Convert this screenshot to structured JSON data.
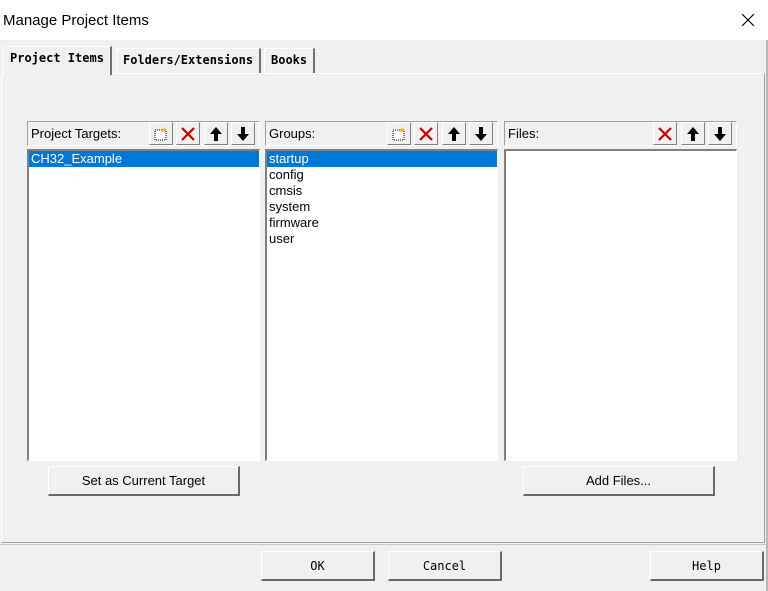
{
  "window": {
    "title": "Manage Project Items"
  },
  "tabs": [
    {
      "label": "Project Items",
      "active": true
    },
    {
      "label": "Folders/Extensions",
      "active": false
    },
    {
      "label": "Books",
      "active": false
    }
  ],
  "targets": {
    "label": "Project Targets:",
    "items": [
      "CH32_Example"
    ],
    "selected": "CH32_Example",
    "button": "Set as Current Target"
  },
  "groups": {
    "label": "Groups:",
    "items": [
      "startup",
      "config",
      "cmsis",
      "system",
      "firmware",
      "user"
    ],
    "selected": "startup"
  },
  "files": {
    "label": "Files:",
    "items": [],
    "button": "Add Files..."
  },
  "footer": {
    "ok": "OK",
    "cancel": "Cancel",
    "help": "Help"
  },
  "icons": {
    "new": "new-item-icon",
    "delete": "delete-icon",
    "up": "move-up-icon",
    "down": "move-down-icon",
    "close": "close-icon"
  },
  "colors": {
    "selection": "#0078d7",
    "delete": "#cc0000"
  }
}
